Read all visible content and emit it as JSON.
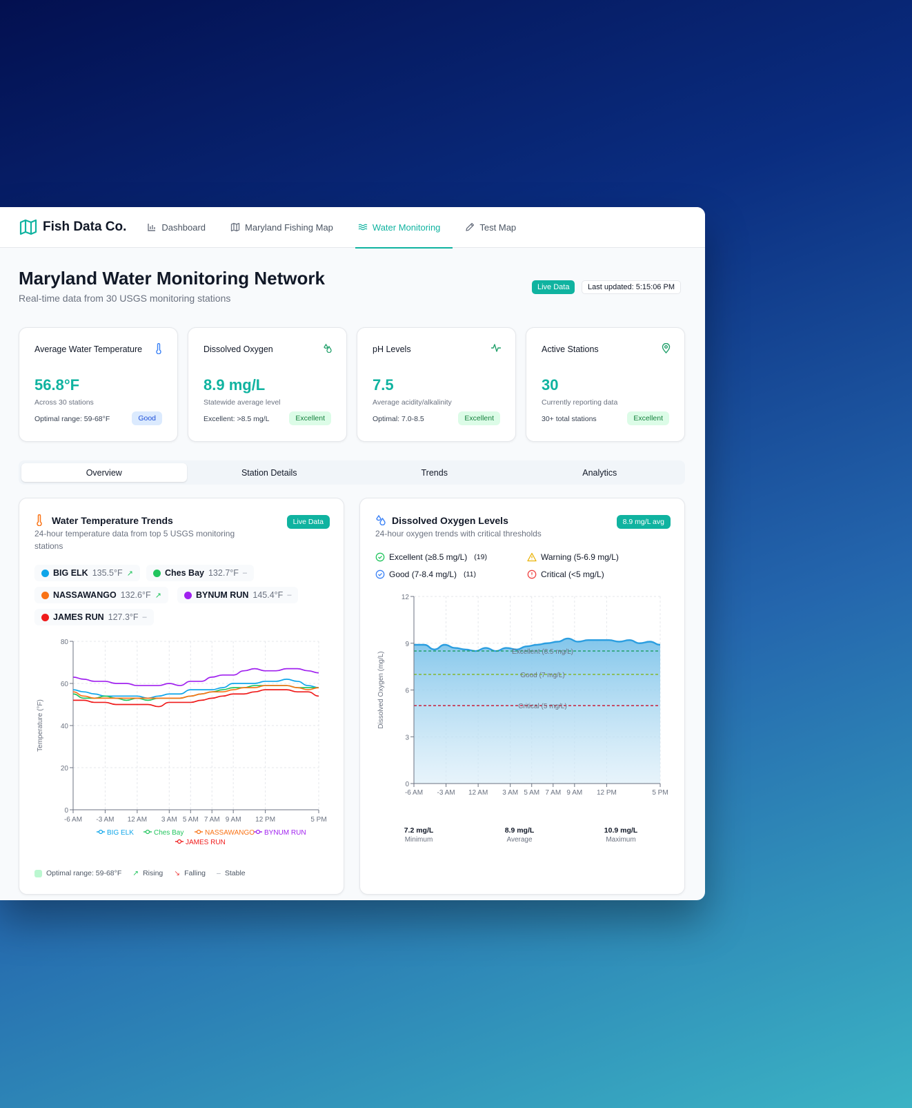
{
  "nav": {
    "brand": "Fish Data Co.",
    "items": [
      {
        "label": "Dashboard",
        "icon": "bar-chart-icon",
        "active": false
      },
      {
        "label": "Maryland Fishing Map",
        "icon": "map-icon",
        "active": false
      },
      {
        "label": "Water Monitoring",
        "icon": "waves-icon",
        "active": true
      },
      {
        "label": "Test Map",
        "icon": "pencil-icon",
        "active": false
      }
    ]
  },
  "header": {
    "title": "Maryland Water Monitoring Network",
    "subtitle": "Real-time data from 30 USGS monitoring stations",
    "live_badge": "Live Data",
    "last_updated": "Last updated: 5:15:06 PM"
  },
  "stats": [
    {
      "title": "Average Water Temperature",
      "icon": "thermometer-icon",
      "value": "56.8°F",
      "desc": "Across 30 stations",
      "foot": "Optimal range: 59-68°F",
      "pill": "Good"
    },
    {
      "title": "Dissolved Oxygen",
      "icon": "droplets-icon",
      "value": "8.9 mg/L",
      "desc": "Statewide average level",
      "foot": "Excellent: >8.5 mg/L",
      "pill": "Excellent"
    },
    {
      "title": "pH Levels",
      "icon": "activity-icon",
      "value": "7.5",
      "desc": "Average acidity/alkalinity",
      "foot": "Optimal: 7.0-8.5",
      "pill": "Excellent"
    },
    {
      "title": "Active Stations",
      "icon": "map-pin-icon",
      "value": "30",
      "desc": "Currently reporting data",
      "foot": "30+ total stations",
      "pill": "Excellent"
    }
  ],
  "tabs": [
    "Overview",
    "Station Details",
    "Trends",
    "Analytics"
  ],
  "temp_panel": {
    "title": "Water Temperature Trends",
    "subtitle_line1": "24-hour temperature data from top 5 USGS monitoring",
    "subtitle_line2": "stations",
    "badge": "Live Data",
    "stations": [
      {
        "name": "BIG ELK",
        "temp": "135.5°F",
        "trend": "rising",
        "color": "#0ea5e9"
      },
      {
        "name": "Ches Bay",
        "temp": "132.7°F",
        "trend": "stable",
        "color": "#22c55e"
      },
      {
        "name": "NASSAWANGO",
        "temp": "132.6°F",
        "trend": "rising",
        "color": "#f97316"
      },
      {
        "name": "BYNUM RUN",
        "temp": "145.4°F",
        "trend": "stable",
        "color": "#a021ef"
      },
      {
        "name": "JAMES RUN",
        "temp": "127.3°F",
        "trend": "stable",
        "color": "#ef1a1a"
      }
    ],
    "footer_legend": {
      "optimal": "Optimal range: 59-68°F",
      "rising": "Rising",
      "falling": "Falling",
      "stable": "Stable"
    }
  },
  "oxygen_panel": {
    "title": "Dissolved Oxygen Levels",
    "subtitle": "24-hour oxygen trends with critical thresholds",
    "badge": "8.9 mg/L avg",
    "legend": {
      "excellent": "Excellent (≥8.5 mg/L)",
      "excellent_count": "(19)",
      "good": "Good (7-8.4 mg/L)",
      "good_count": "(11)",
      "warning": "Warning (5-6.9 mg/L)",
      "critical": "Critical (<5 mg/L)"
    },
    "summary": [
      {
        "value": "7.2 mg/L",
        "label": "Minimum"
      },
      {
        "value": "8.9 mg/L",
        "label": "Average"
      },
      {
        "value": "10.9 mg/L",
        "label": "Maximum"
      }
    ]
  },
  "chart_data": [
    {
      "type": "line",
      "title": "Water Temperature Trends",
      "ylabel": "Temperature (°F)",
      "ylim": [
        0,
        80
      ],
      "yticks": [
        0,
        20,
        40,
        60,
        80
      ],
      "x": [
        "-6 AM",
        "-5 AM",
        "-4 AM",
        "-3 AM",
        "-2 AM",
        "-1 AM",
        "12 AM",
        "1 AM",
        "2 AM",
        "3 AM",
        "4 AM",
        "5 AM",
        "6 AM",
        "7 AM",
        "8 AM",
        "9 AM",
        "10 AM",
        "11 AM",
        "12 PM",
        "1 PM",
        "2 PM",
        "3 PM",
        "4 PM",
        "5 PM"
      ],
      "xticks": [
        "-6 AM",
        "-3 AM",
        "12 AM",
        "3 AM",
        "5 AM",
        "7 AM",
        "9 AM",
        "12 PM",
        "5 PM"
      ],
      "legend_position": "bottom",
      "grid": true,
      "series": [
        {
          "name": "BIG ELK",
          "color": "#0ea5e9",
          "values": [
            57,
            56,
            55,
            54,
            54,
            54,
            54,
            53,
            54,
            55,
            55,
            57,
            57,
            57,
            58,
            60,
            60,
            60,
            61,
            61,
            62,
            61,
            59,
            58
          ]
        },
        {
          "name": "Ches Bay",
          "color": "#22c55e",
          "values": [
            55,
            53,
            53,
            54,
            53,
            52,
            53,
            52,
            53,
            53,
            53,
            54,
            55,
            56,
            57,
            58,
            58,
            59,
            59,
            59,
            59,
            58,
            58,
            58
          ]
        },
        {
          "name": "NASSAWANGO",
          "color": "#f97316",
          "values": [
            56,
            54,
            53,
            53,
            53,
            53,
            53,
            53,
            53,
            53,
            53,
            54,
            55,
            56,
            56,
            57,
            58,
            58,
            59,
            59,
            59,
            58,
            57,
            58
          ]
        },
        {
          "name": "BYNUM RUN",
          "color": "#a021ef",
          "values": [
            63,
            62,
            61,
            61,
            60,
            60,
            59,
            59,
            59,
            60,
            59,
            61,
            61,
            63,
            64,
            64,
            66,
            67,
            66,
            66,
            67,
            67,
            66,
            65
          ]
        },
        {
          "name": "JAMES RUN",
          "color": "#ef1a1a",
          "values": [
            52,
            52,
            51,
            51,
            50,
            50,
            50,
            50,
            49,
            51,
            51,
            51,
            52,
            53,
            54,
            55,
            55,
            56,
            57,
            57,
            57,
            56,
            56,
            54
          ]
        }
      ]
    },
    {
      "type": "area",
      "title": "Dissolved Oxygen Levels",
      "ylabel": "Dissolved Oxygen (mg/L)",
      "ylim": [
        0,
        12
      ],
      "yticks": [
        0,
        3,
        6,
        9,
        12
      ],
      "xticks": [
        "-6 AM",
        "-3 AM",
        "12 AM",
        "3 AM",
        "5 AM",
        "7 AM",
        "9 AM",
        "12 PM",
        "5 PM"
      ],
      "grid": true,
      "series": [
        {
          "name": "Dissolved Oxygen",
          "color": "#2b9ee0",
          "values": [
            8.9,
            8.9,
            8.6,
            8.9,
            8.7,
            8.6,
            8.5,
            8.7,
            8.5,
            8.7,
            8.6,
            8.8,
            8.9,
            9.0,
            9.1,
            9.3,
            9.1,
            9.2,
            9.2,
            9.2,
            9.1,
            9.2,
            9.0,
            9.1,
            8.9
          ]
        }
      ],
      "thresholds": [
        {
          "label": "Excellent (8.5 mg/L)",
          "value": 8.5,
          "color": "#22a06b"
        },
        {
          "label": "Good (7 mg/L)",
          "value": 7,
          "color": "#84b82e"
        },
        {
          "label": "Critical (5 mg/L)",
          "value": 5,
          "color": "#c81e3a"
        }
      ]
    }
  ]
}
